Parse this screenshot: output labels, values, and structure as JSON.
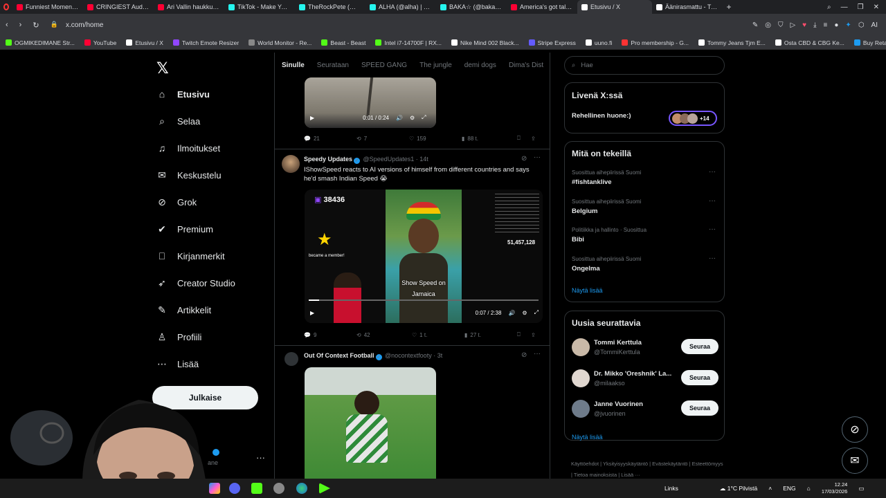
{
  "browser": {
    "tabs": [
      {
        "title": "Funniest Moments That M",
        "color": "#ff0033"
      },
      {
        "title": "CRINGIEST Auditions! Try",
        "color": "#ff0033"
      },
      {
        "title": "Ari Vallin haukkui studios",
        "color": "#ff0033"
      },
      {
        "title": "TikTok - Make Your Day",
        "color": "#25f4ee"
      },
      {
        "title": "TheRockPete (@therockp",
        "color": "#25f4ee"
      },
      {
        "title": "ALHA (@alha) | TikTok",
        "color": "#25f4ee"
      },
      {
        "title": "BAKA☆ (@bakaflockafla",
        "color": "#25f4ee"
      },
      {
        "title": "America's got talent wor",
        "color": "#ff0033"
      },
      {
        "title": "Etusivu / X",
        "color": "#ffffff",
        "active": true
      },
      {
        "title": "Äänirasmattu - Tule usko",
        "color": "#ffffff"
      }
    ],
    "new_tab": "+",
    "url": "x.com/home",
    "bookmarks": [
      {
        "label": "OGMIKEDIMANE Str...",
        "color": "#53fc18"
      },
      {
        "label": "YouTube",
        "color": "#ff0033"
      },
      {
        "label": "Etusivu / X",
        "color": "#ffffff"
      },
      {
        "label": "Twitch Emote Resizer",
        "color": "#9146ff"
      },
      {
        "label": "World Monitor - Re...",
        "color": "#888888"
      },
      {
        "label": "Beast - Beast",
        "color": "#53fc18"
      },
      {
        "label": "Intel i7-14700F | RX...",
        "color": "#53fc18"
      },
      {
        "label": "Nike Mind 002 Black...",
        "color": "#ffffff"
      },
      {
        "label": "Stripe Express",
        "color": "#635bff"
      },
      {
        "label": "uuno.fi",
        "color": "#ffffff"
      },
      {
        "label": "Pro membership - G...",
        "color": "#ff3333"
      },
      {
        "label": "Tommy Jeans Tjm E...",
        "color": "#ffffff"
      },
      {
        "label": "Osta CBD & CBG Ke...",
        "color": "#ffffff"
      },
      {
        "label": "Buy Retatrutide 10m...",
        "color": "#1d9bf0"
      }
    ]
  },
  "nav": {
    "items": [
      {
        "label": "Etusivu",
        "icon": "home-icon"
      },
      {
        "label": "Selaa",
        "icon": "search-icon"
      },
      {
        "label": "Ilmoitukset",
        "icon": "bell-icon"
      },
      {
        "label": "Keskustelu",
        "icon": "mail-icon"
      },
      {
        "label": "Grok",
        "icon": "grok-icon"
      },
      {
        "label": "Premium",
        "icon": "premium-icon"
      },
      {
        "label": "Kirjanmerkit",
        "icon": "bookmark-icon"
      },
      {
        "label": "Creator Studio",
        "icon": "rocket-icon"
      },
      {
        "label": "Artikkelit",
        "icon": "article-icon"
      },
      {
        "label": "Profiili",
        "icon": "person-icon"
      },
      {
        "label": "Lisää",
        "icon": "more-icon"
      }
    ],
    "post_label": "Julkaise",
    "account_handle_fragment": "ane",
    "account_more": "···"
  },
  "feed": {
    "tabs": [
      "Sinulle",
      "Seurataan",
      "SPEED GANG",
      "The jungle",
      "demi dogs",
      "Dima's Dist"
    ],
    "tweet1": {
      "video_time": "0:01 / 0:24",
      "replies": "21",
      "reposts": "7",
      "likes": "159",
      "views": "88 t."
    },
    "tweet2": {
      "name": "Speedy Updates",
      "handle": "@SpeedUpdates1",
      "time": "· 14t",
      "text": "IShowSpeed reacts to AI versions of himself from different countries and says he'd smash Indian Speed 😭",
      "video_time": "0:07 / 2:38",
      "overlay_count": "38436",
      "overlay_caption1": "Show Speed on",
      "overlay_caption2": "Jamaica",
      "overlay_side": "51,457,128",
      "overlay_member": "became a member!",
      "replies": "9",
      "reposts": "42",
      "likes": "1 t.",
      "views": "27 t."
    },
    "tweet3": {
      "name": "Out Of Context Football",
      "handle": "@nocontextfooty",
      "time": "· 3t"
    }
  },
  "sidebar": {
    "search_placeholder": "Hae",
    "live": {
      "title": "Livenä X:ssä",
      "space_name": "Rehellinen huone:)",
      "listener_count": "+14"
    },
    "trends": {
      "title": "Mitä on tekeillä",
      "items": [
        {
          "meta": "Suosittua aihepiirissä Suomi",
          "name": "#fishtanklive"
        },
        {
          "meta": "Suosittua aihepiirissä Suomi",
          "name": "Belgium"
        },
        {
          "meta": "Politiikka ja hallinto · Suosittua",
          "name": "Bibi"
        },
        {
          "meta": "Suosittua aihepiirissä Suomi",
          "name": "Ongelma"
        }
      ],
      "show_more": "Näytä lisää"
    },
    "who_to_follow": {
      "title": "Uusia seurattavia",
      "items": [
        {
          "name": "Tommi Kerttula",
          "handle": "@TommiKerttula",
          "button": "Seuraa"
        },
        {
          "name": "Dr. Mikko 'Oreshnik' La...",
          "handle": "@milaakso",
          "button": "Seuraa"
        },
        {
          "name": "Janne Vuorinen",
          "handle": "@jvuorinen",
          "button": "Seuraa"
        }
      ],
      "show_more": "Näytä lisää"
    },
    "footer": [
      "Käyttöehdot",
      "Yksityisyyskäytäntö",
      "Evästekäytäntö",
      "Esteettömyys",
      "Tietoa mainoksista",
      "Lisää ···"
    ]
  },
  "taskbar": {
    "links": "Links",
    "weather": "1°C  Pilvistä",
    "lang": "ENG",
    "time": "12.24",
    "date": "17/03/2026"
  }
}
